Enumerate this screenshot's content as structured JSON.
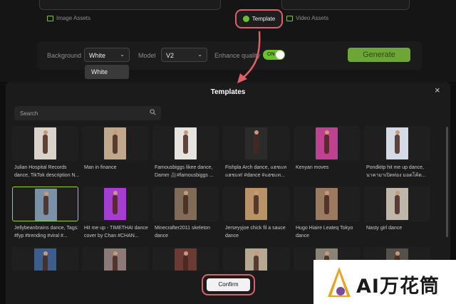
{
  "top_panel": {
    "image_assets_label": "Image Assets",
    "template_label": "Template",
    "video_assets_label": "Video Assets",
    "background_label": "Background",
    "background_value": "White",
    "model_label": "Model",
    "model_value": "V2",
    "enhance_label": "Enhance quality",
    "enhance_toggle": "ON",
    "generate_label": "Generate",
    "dropdown_option": "White"
  },
  "modal": {
    "title": "Templates",
    "close_glyph": "×",
    "search_placeholder": "Search",
    "confirm_label": "Confirm"
  },
  "templates": [
    {
      "caption": "Julian Hospital Records dance, TikTok description N...",
      "color": "#d9d3cb"
    },
    {
      "caption": "Man in finance",
      "color": "#bfa98a"
    },
    {
      "caption": "Famousbiggs likee dance, Damm 🎥#famousbiggs ...",
      "color": "#e7e4df"
    },
    {
      "caption": "Fishpla Arch dance, แฮชแท แฮชแท! #dance #แฮชแท...",
      "color": "#2b2b2b"
    },
    {
      "caption": "Kenyan moves",
      "color": "#c0418f"
    },
    {
      "caption": "Pondkitp hit me up dance, นาคามาเปิดท่อง มอดโค้ต...",
      "color": "#d5dbe4"
    },
    {
      "caption": "Jellybeanbrains dance, Tags: #fyp #trending #viral #...",
      "color": "#7a92a8"
    },
    {
      "caption": "Hit me up - TIMETHAI dance cover by Chan #CHAN...",
      "color": "#a53dd1"
    },
    {
      "caption": "Minecrafter2011 skeleton dance",
      "color": "#7f6b58"
    },
    {
      "caption": "Jerseyyjoe chick fil a sauce dance",
      "color": "#b89368"
    },
    {
      "caption": "Hugo Hiaire Leateq Tokyo dance",
      "color": "#9a7a60"
    },
    {
      "caption": "Nasty girl dance",
      "color": "#c0b7ab"
    },
    {
      "caption": "",
      "color": "#3d5d8a"
    },
    {
      "caption": "",
      "color": "#8c7a78"
    },
    {
      "caption": "",
      "color": "#6a3a34"
    },
    {
      "caption": "",
      "color": "#b7a892"
    },
    {
      "caption": "",
      "color": "#8a8477"
    },
    {
      "caption": "",
      "color": "#56504b"
    }
  ],
  "watermark": {
    "text": "AI万花筒"
  },
  "colors": {
    "accent_green": "#6ac02e",
    "highlight_red": "#e0606a"
  }
}
